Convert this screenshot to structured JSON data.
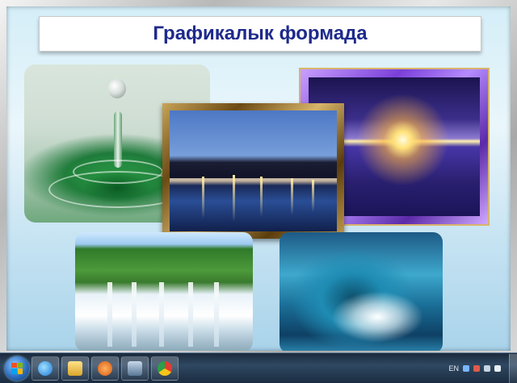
{
  "slide": {
    "title": "Графикалык формада",
    "pictures": [
      {
        "name": "water-drop"
      },
      {
        "name": "sunset-sea"
      },
      {
        "name": "moscow-river"
      },
      {
        "name": "waterfall"
      },
      {
        "name": "ocean-wave"
      }
    ]
  },
  "taskbar": {
    "buttons": [
      {
        "icon": "internet-explorer-icon"
      },
      {
        "icon": "folder-icon"
      },
      {
        "icon": "media-player-icon"
      },
      {
        "icon": "app-icon"
      },
      {
        "icon": "chrome-icon"
      }
    ],
    "tray": {
      "language": "EN"
    }
  },
  "colors": {
    "title_text": "#1e2a8c",
    "slide_bg": "#d4eef8",
    "taskbar_bg": "#2f4862"
  }
}
